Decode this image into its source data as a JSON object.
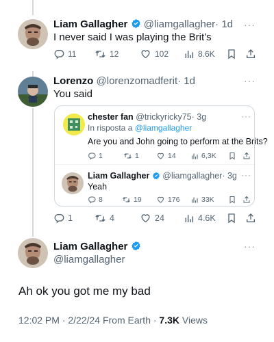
{
  "tweet1": {
    "name": "Liam Gallagher",
    "handle": "@liamgallagher",
    "time": "· 1d",
    "text": "I never said I was playing the Brit’s",
    "replies": "11",
    "retweets": "12",
    "likes": "102",
    "views": "8.6K"
  },
  "tweet2": {
    "name": "Lorenzo",
    "handle": "@lorenzomadferit",
    "time": "· 1d",
    "text": "You said",
    "replies": "1",
    "retweets": "4",
    "likes": "24",
    "views": "4.6K"
  },
  "quote1": {
    "name": "chester fan",
    "handle": "@trickyricky75",
    "time": "· 3g",
    "reply_prefix": "In risposta a",
    "reply_to": "@liamgallagher",
    "text": "Are you and John going to perform at the Brits?",
    "replies": "1",
    "retweets": "1",
    "likes": "14",
    "views": "6,3K"
  },
  "quote2": {
    "name": "Liam Gallagher",
    "handle": "@liamgallagher",
    "time": "· 3g",
    "text": "Yeah",
    "replies": "8",
    "retweets": "19",
    "likes": "176",
    "views": "33K"
  },
  "main": {
    "name": "Liam Gallagher",
    "handle": "@liamgallagher",
    "text": "Ah ok you got me my bad",
    "meta_prefix": "12:02 PM · 2/22/24 From Earth ·",
    "views_count": "7.3K",
    "views_label": "Views"
  },
  "more_glyph": "···",
  "colors": {
    "verified": "#1d9bf0",
    "link": "#1d9bf0",
    "icon": "#536471",
    "border": "#cfd9de"
  },
  "icons": [
    "reply-icon",
    "retweet-icon",
    "like-icon",
    "views-icon",
    "bookmark-icon",
    "share-icon",
    "verified-badge-icon",
    "more-icon"
  ]
}
